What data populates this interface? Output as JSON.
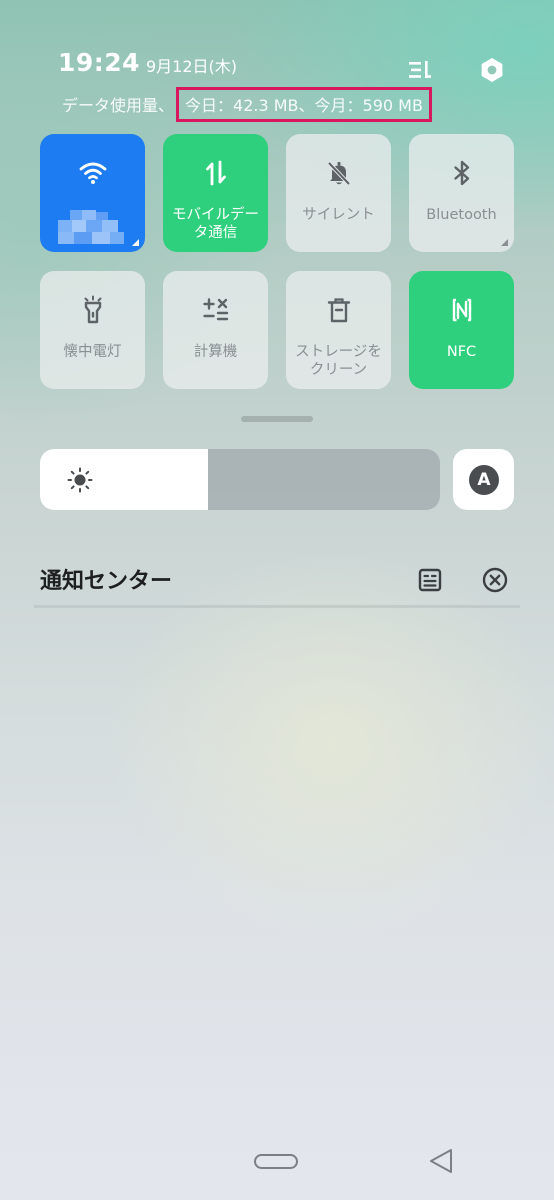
{
  "status": {
    "time": "19:24",
    "date": "9月12日(木)",
    "data_usage_prefix": "データ使用量、",
    "data_usage_value": "今日：42.3 MB、今月：590 MB"
  },
  "header_icons": {
    "edit": "edit-tiles-icon",
    "settings": "settings-hexagon-icon"
  },
  "tiles": [
    {
      "id": "wifi",
      "label": "",
      "icon": "wifi-icon",
      "state": "active",
      "color": "#1d7cf2"
    },
    {
      "id": "mobile-data",
      "label": "モバイルデータ通信",
      "icon": "data-arrows-icon",
      "state": "active",
      "color": "#2fd07d"
    },
    {
      "id": "silent",
      "label": "サイレント",
      "icon": "bell-off-icon",
      "state": "inactive"
    },
    {
      "id": "bluetooth",
      "label": "Bluetooth",
      "icon": "bluetooth-icon",
      "state": "inactive"
    },
    {
      "id": "flashlight",
      "label": "懐中電灯",
      "icon": "flashlight-icon",
      "state": "inactive"
    },
    {
      "id": "calculator",
      "label": "計算機",
      "icon": "calculator-icon",
      "state": "inactive"
    },
    {
      "id": "clean-storage",
      "label": "ストレージをクリーン",
      "icon": "trash-icon",
      "state": "inactive"
    },
    {
      "id": "nfc",
      "label": "NFC",
      "icon": "nfc-icon",
      "state": "active",
      "color": "#2fd07d"
    }
  ],
  "tile_labels": {
    "mobile_line1": "モバイルデー",
    "mobile_line2": "タ通信",
    "storage_line1": "ストレージを",
    "storage_line2": "クリーン"
  },
  "brightness": {
    "level_percent": 42,
    "auto_label": "A"
  },
  "notification_center": {
    "title": "通知センター"
  },
  "colors": {
    "active_blue": "#1d7cf2",
    "active_green": "#2fd07d",
    "highlight_border": "#d9175e"
  }
}
